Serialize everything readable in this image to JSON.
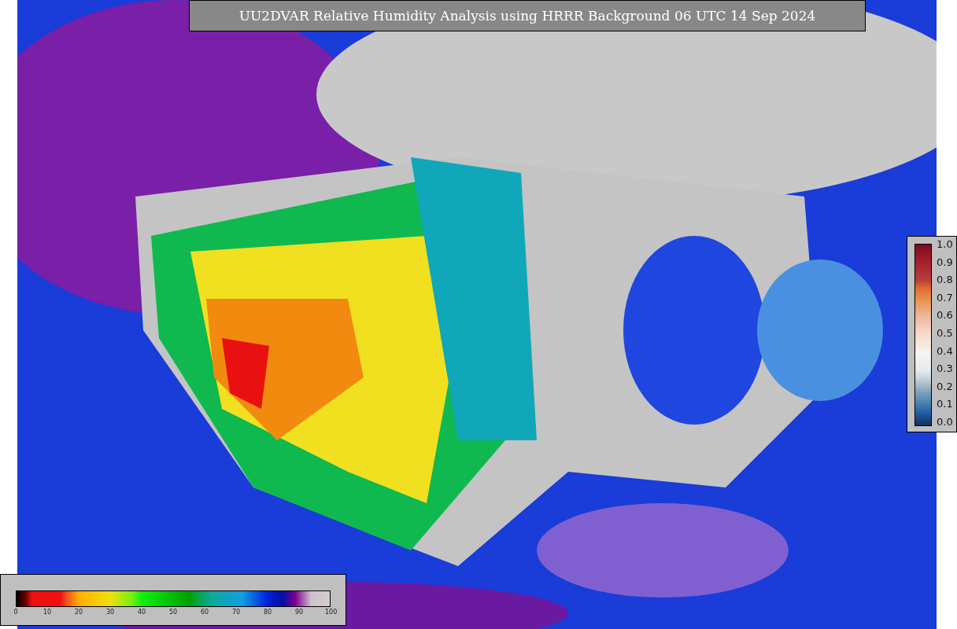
{
  "title": "UU2DVAR Relative Humidity Analysis using HRRR Background 06 UTC 14 Sep 2024",
  "humidity_legend": {
    "ticks": [
      "0",
      "10",
      "20",
      "30",
      "40",
      "50",
      "60",
      "70",
      "80",
      "90",
      "100"
    ]
  },
  "ratio_legend": {
    "ticks": [
      "1.0",
      "0.9",
      "0.8",
      "0.7",
      "0.6",
      "0.5",
      "0.4",
      "0.3",
      "0.2",
      "0.1",
      "0.0"
    ]
  }
}
